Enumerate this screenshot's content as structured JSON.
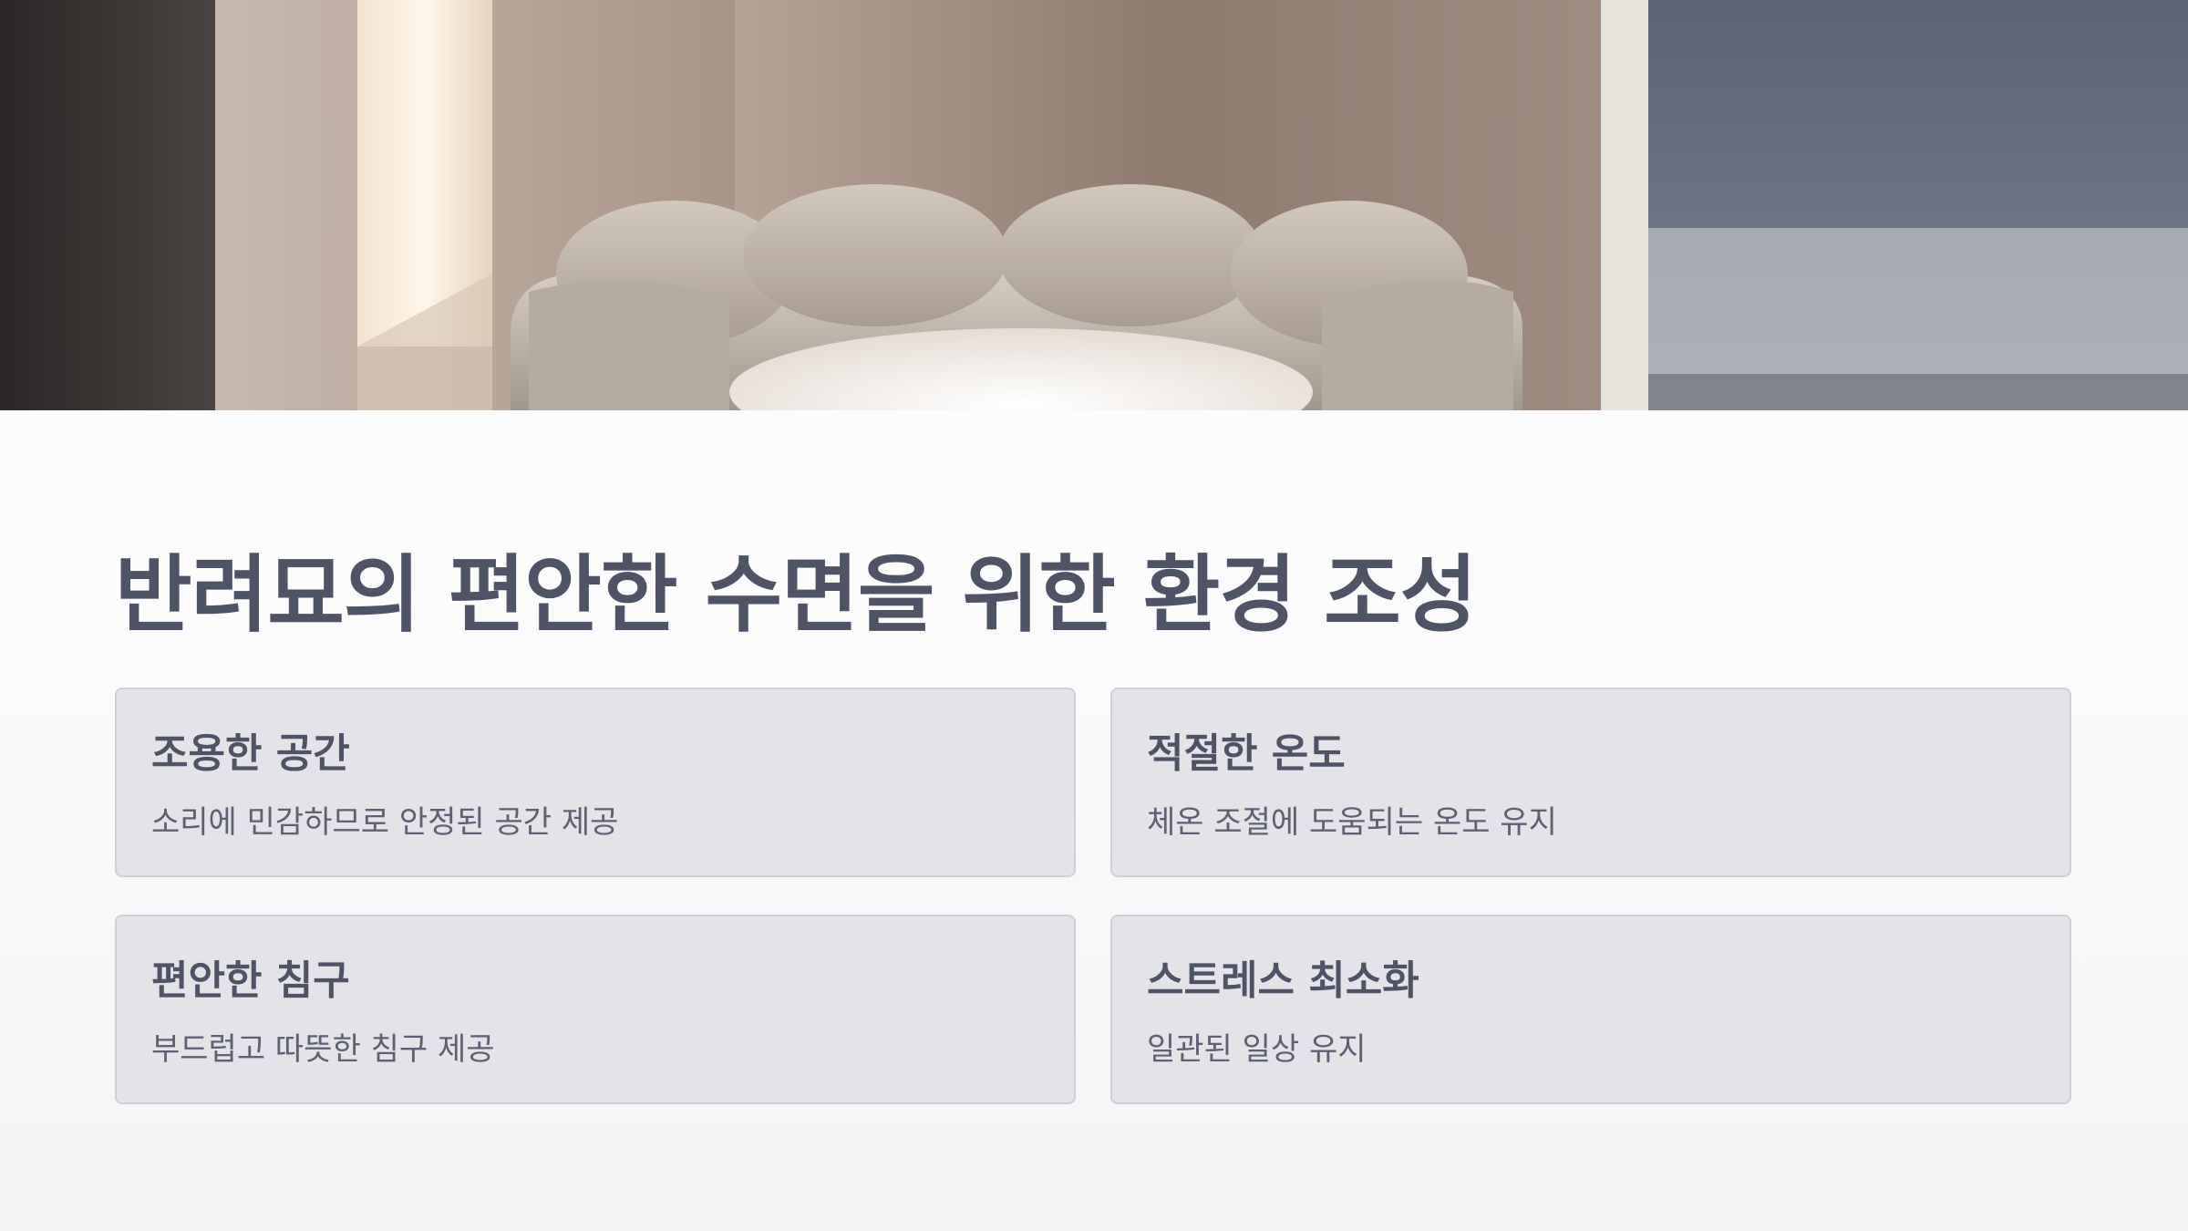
{
  "slide": {
    "title": "반려묘의 편안한 수면을 위한 환경 조성",
    "banner_image": "cozy-pet-bed-photo",
    "cards": [
      {
        "title": "조용한 공간",
        "description": "소리에 민감하므로 안정된 공간 제공"
      },
      {
        "title": "적절한 온도",
        "description": "체온 조절에 도움되는 온도 유지"
      },
      {
        "title": "편안한 침구",
        "description": "부드럽고 따뜻한 침구 제공"
      },
      {
        "title": "스트레스 최소화",
        "description": "일관된 일상 유지"
      }
    ]
  },
  "colors": {
    "title": "#4f5366",
    "card_background": "#e3e3e8",
    "card_border": "#cfcfd6",
    "description": "#5d6173"
  }
}
